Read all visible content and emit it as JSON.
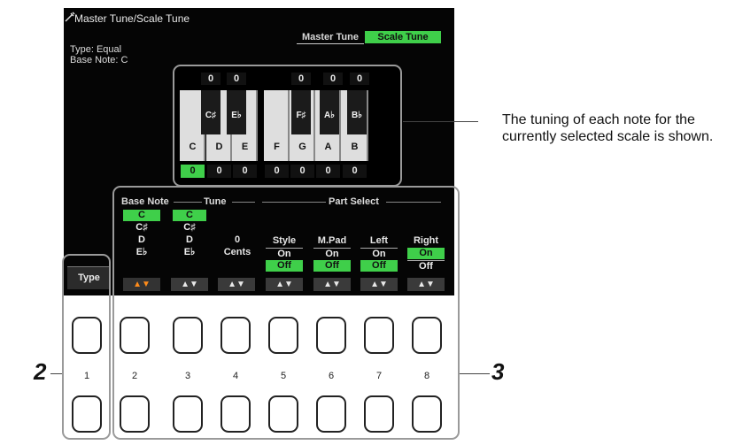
{
  "screen": {
    "title": "Master Tune/Scale Tune",
    "tabs": [
      "Master Tune",
      "Scale Tune"
    ],
    "type_line": "Type: Equal",
    "base_note_line": "Base Note: C"
  },
  "keyboard": {
    "black_cents": [
      "0",
      "0",
      "0",
      "0",
      "0"
    ],
    "black_keys": [
      "C♯",
      "E♭",
      "F♯",
      "A♭",
      "B♭"
    ],
    "white_keys": [
      "C",
      "D",
      "E",
      "F",
      "G",
      "A",
      "B"
    ],
    "white_cents": [
      "0",
      "0",
      "0",
      "0",
      "0",
      "0",
      "0"
    ]
  },
  "panel": {
    "header_base_note": "Base Note",
    "header_tune": "Tune",
    "header_part_select": "Part Select",
    "base_note_list": [
      "C",
      "C♯",
      "D",
      "E♭"
    ],
    "tune_list": [
      "C",
      "C♯",
      "D",
      "E♭"
    ],
    "cents_value": "0",
    "cents_label": "Cents",
    "parts": [
      {
        "name": "Style",
        "on": "On",
        "off": "Off"
      },
      {
        "name": "M.Pad",
        "on": "On",
        "off": "Off"
      },
      {
        "name": "Left",
        "on": "On",
        "off": "Off"
      },
      {
        "name": "Right",
        "on": "On",
        "off": "Off"
      }
    ],
    "arrows": [
      "▲▼",
      "▲▼",
      "▲▼",
      "▲▼",
      "▲▼",
      "▲▼",
      "▲▼"
    ],
    "type_button": "Type"
  },
  "hardware": {
    "numbers": [
      "1",
      "2",
      "3",
      "4",
      "5",
      "6",
      "7",
      "8"
    ]
  },
  "annotations": {
    "callout": "The tuning of each note for the currently selected scale is shown.",
    "marker_left": "2",
    "marker_right": "3"
  }
}
